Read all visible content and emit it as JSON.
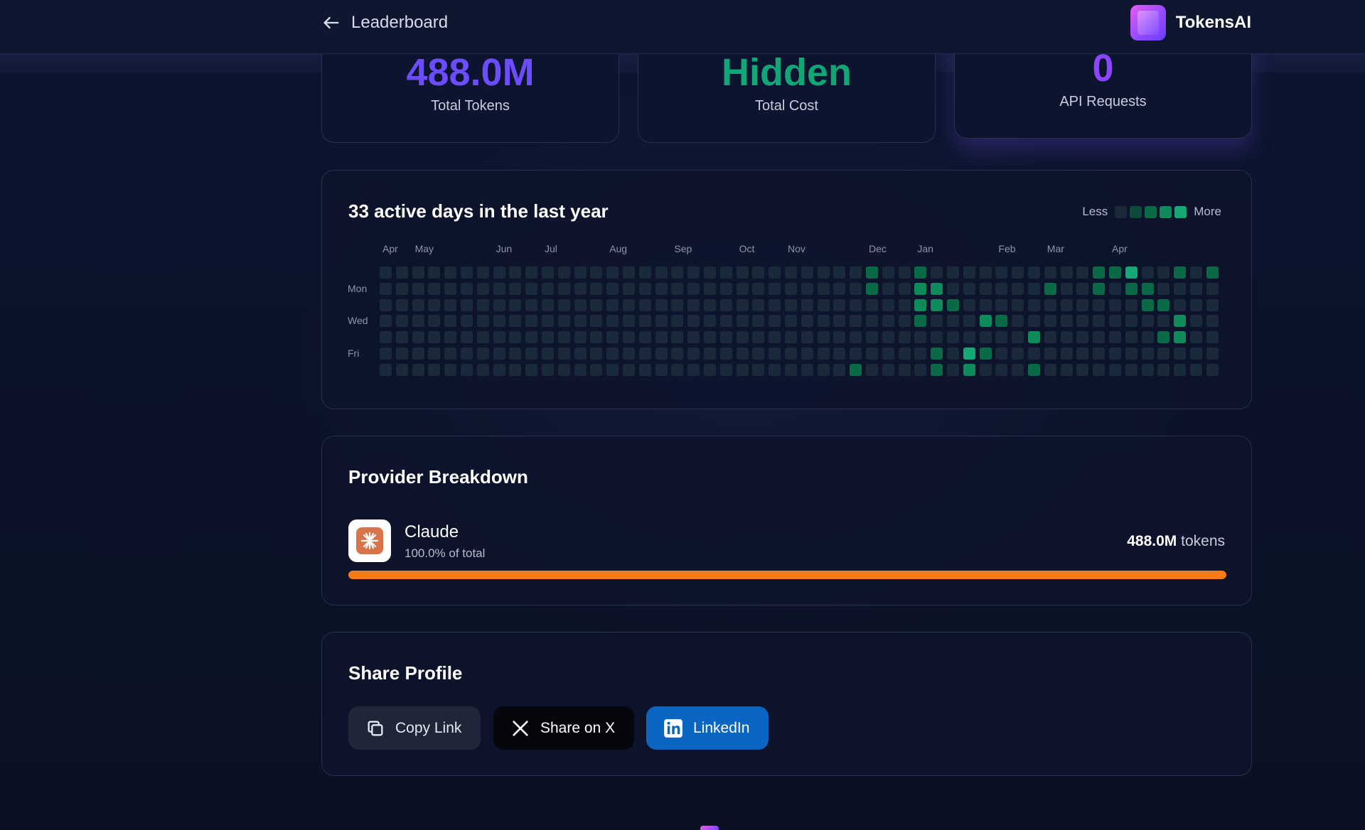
{
  "header": {
    "back_label": "Leaderboard",
    "brand_name": "TokensAI"
  },
  "stats": {
    "total_tokens": {
      "value": "488.0M",
      "label": "Total Tokens"
    },
    "total_cost": {
      "value": "Hidden",
      "label": "Total Cost"
    },
    "api_requests": {
      "value": "0",
      "label": "API Requests"
    }
  },
  "activity": {
    "title": "33 active days in the last year",
    "legend_less": "Less",
    "legend_more": "More",
    "months": [
      {
        "label": "Apr",
        "week": 0
      },
      {
        "label": "May",
        "week": 2
      },
      {
        "label": "Jun",
        "week": 7
      },
      {
        "label": "Jul",
        "week": 10
      },
      {
        "label": "Aug",
        "week": 14
      },
      {
        "label": "Sep",
        "week": 18
      },
      {
        "label": "Oct",
        "week": 22
      },
      {
        "label": "Nov",
        "week": 25
      },
      {
        "label": "Dec",
        "week": 30
      },
      {
        "label": "Jan",
        "week": 33
      },
      {
        "label": "Feb",
        "week": 38
      },
      {
        "label": "Mar",
        "week": 41
      },
      {
        "label": "Apr",
        "week": 45
      }
    ],
    "day_labels": [
      {
        "label": "Mon",
        "row": 1
      },
      {
        "label": "Wed",
        "row": 3
      },
      {
        "label": "Fri",
        "row": 5
      }
    ],
    "weeks": 52,
    "level_colors": [
      "#1b2a3a",
      "#0c4a3a",
      "#0a6a48",
      "#0f8a5a",
      "#13a874"
    ],
    "active_cells": [
      [
        30,
        0,
        2
      ],
      [
        30,
        1,
        2
      ],
      [
        29,
        6,
        2
      ],
      [
        33,
        0,
        2
      ],
      [
        33,
        1,
        3
      ],
      [
        34,
        1,
        3
      ],
      [
        33,
        2,
        3
      ],
      [
        34,
        2,
        3
      ],
      [
        35,
        2,
        2
      ],
      [
        33,
        3,
        2
      ],
      [
        34,
        5,
        2
      ],
      [
        34,
        6,
        2
      ],
      [
        36,
        5,
        4
      ],
      [
        37,
        5,
        2
      ],
      [
        36,
        6,
        3
      ],
      [
        37,
        3,
        3
      ],
      [
        38,
        3,
        2
      ],
      [
        40,
        4,
        3
      ],
      [
        40,
        6,
        2
      ],
      [
        41,
        1,
        2
      ],
      [
        44,
        0,
        2
      ],
      [
        44,
        1,
        2
      ],
      [
        45,
        0,
        2
      ],
      [
        46,
        0,
        4
      ],
      [
        46,
        1,
        2
      ],
      [
        47,
        1,
        2
      ],
      [
        47,
        2,
        2
      ],
      [
        48,
        2,
        2
      ],
      [
        49,
        0,
        2
      ],
      [
        49,
        3,
        3
      ],
      [
        48,
        4,
        2
      ],
      [
        49,
        4,
        3
      ],
      [
        51,
        0,
        2
      ]
    ]
  },
  "provider": {
    "title": "Provider Breakdown",
    "name": "Claude",
    "share_label": "100.0% of total",
    "share_fraction": 1.0,
    "tokens_value": "488.0M",
    "tokens_unit": "tokens",
    "bar_color": "#ff7a10"
  },
  "share": {
    "title": "Share Profile",
    "copy_label": "Copy Link",
    "x_label": "Share on X",
    "linkedin_label": "LinkedIn"
  }
}
